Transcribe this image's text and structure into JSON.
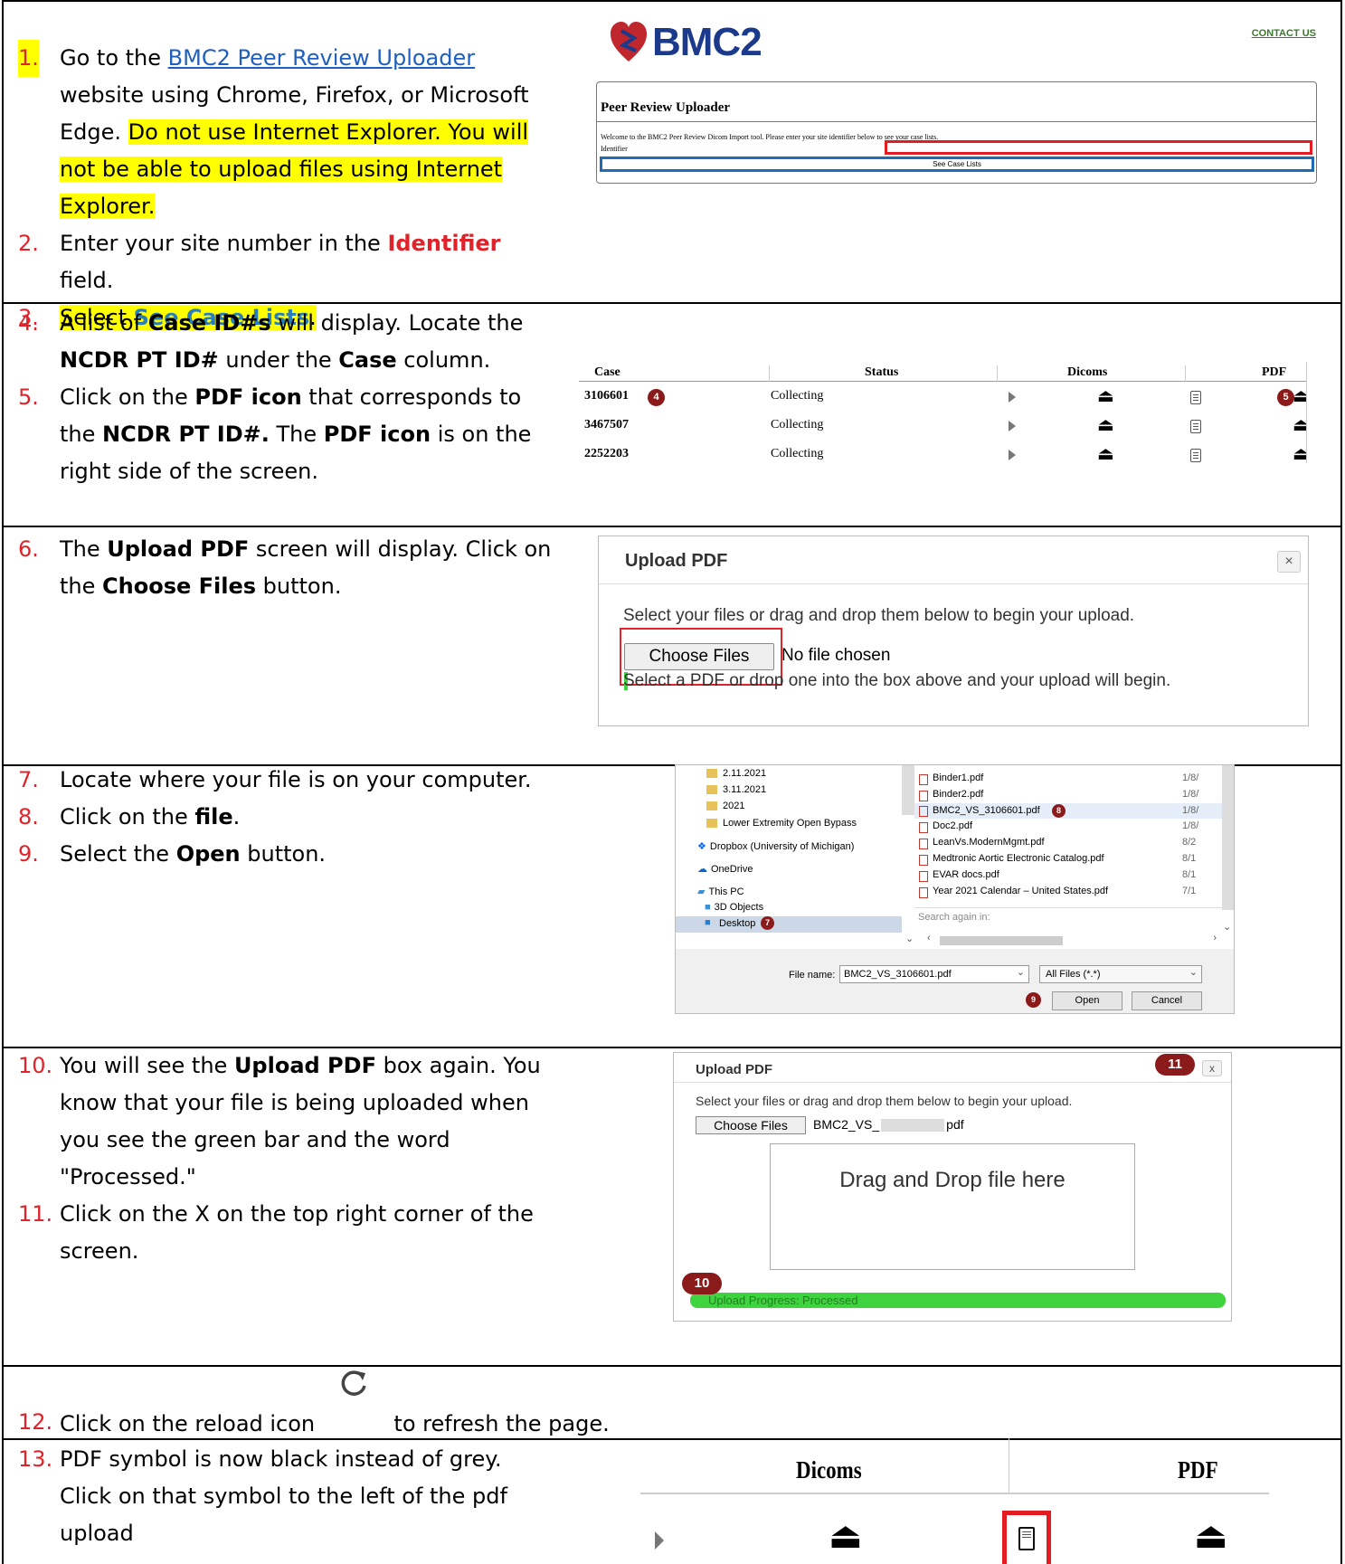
{
  "steps": {
    "s1": {
      "num": "1.",
      "pre": "Go to the ",
      "link": "BMC2 Peer Review Uploader",
      "post": " website using Chrome, Firefox, or Microsoft Edge. ",
      "warn": "Do not use Internet Explorer. You will not be able to upload files using Internet Explorer."
    },
    "s2": {
      "num": "2.",
      "pre": "Enter your site number in the ",
      "bold": "Identifier",
      "post": " field."
    },
    "s3": {
      "num": "3.",
      "pre": "Select ",
      "bold": "See Case Lists",
      "post": "."
    },
    "s4": {
      "num": "4.",
      "a": "A list of ",
      "b1": "Case ID#s",
      "c": " will display. Locate the ",
      "b2": "NCDR PT ID#",
      "d": " under the ",
      "b3": "Case",
      "e": " column."
    },
    "s5": {
      "num": "5.",
      "a": "Click on the ",
      "b1": "PDF icon",
      "c": " that corresponds to the ",
      "b2": "NCDR PT ID#.",
      "d": " The ",
      "b3": "PDF icon",
      "e": " is on the right side of the screen."
    },
    "s6": {
      "num": "6.",
      "a": "The ",
      "b1": "Upload PDF",
      "c": " screen will display. Click on the ",
      "b2": "Choose Files",
      "d": " button."
    },
    "s7": {
      "num": "7.",
      "text": "Locate where your file is on your computer."
    },
    "s8": {
      "num": "8.",
      "a": "Click on the ",
      "b1": "file",
      "c": "."
    },
    "s9": {
      "num": "9.",
      "a": "Select the ",
      "b1": "Open",
      "c": " button."
    },
    "s10": {
      "num": "10.",
      "a": "You will see the ",
      "b1": "Upload PDF",
      "c": " box again. You know that your file is being uploaded when you see the green bar and the word \"Processed.\""
    },
    "s11": {
      "num": "11.",
      "text": "Click on the X on the top right corner of the screen."
    },
    "s12": {
      "num": "12.",
      "a": "Click on the reload icon",
      "c": "to refresh the page."
    },
    "s13": {
      "num": "13.",
      "text": "PDF symbol is now black instead of grey. Click on that symbol to the left of the pdf upload"
    }
  },
  "uploader": {
    "logo": "BMC2",
    "contact": "CONTACT US",
    "title": "Peer Review Uploader",
    "welcome": "Welcome to the BMC2 Peer Review Dicom Import tool. Please enter your site identifier below to see your case lists.",
    "identifier_label": "Identifier",
    "button": "See Case Lists"
  },
  "case_table": {
    "headers": [
      "Case",
      "Status",
      "Dicoms",
      "PDF"
    ],
    "rows": [
      {
        "case": "3106601",
        "status": "Collecting"
      },
      {
        "case": "3467507",
        "status": "Collecting"
      },
      {
        "case": "2252203",
        "status": "Collecting"
      }
    ],
    "badge_case": "4",
    "badge_pdf": "5"
  },
  "upload_dialog": {
    "title": "Upload PDF",
    "close": "×",
    "instruction": "Select your files or drag and drop them below to begin your upload.",
    "choose": "Choose Files",
    "no_file": "No file chosen",
    "hint": "Select a PDF or drop one into the box above and your upload will begin."
  },
  "file_dialog": {
    "left_items": [
      "2.11.2021",
      "3.11.2021",
      "2021",
      "Lower Extremity Open Bypass",
      "Dropbox (University of Michigan)",
      "OneDrive",
      "This PC",
      "3D Objects",
      "Desktop"
    ],
    "files": [
      {
        "name": "Binder1.pdf",
        "date": "1/8/"
      },
      {
        "name": "Binder2.pdf",
        "date": "1/8/"
      },
      {
        "name": "BMC2_VS_3106601.pdf",
        "date": "1/8/"
      },
      {
        "name": "Doc2.pdf",
        "date": "1/8/"
      },
      {
        "name": "LeanVs.ModernMgmt.pdf",
        "date": "8/2"
      },
      {
        "name": "Medtronic Aortic Electronic Catalog.pdf",
        "date": "8/1"
      },
      {
        "name": "EVAR docs.pdf",
        "date": "8/1"
      },
      {
        "name": "Year 2021 Calendar – United States.pdf",
        "date": "7/1"
      }
    ],
    "search_again": "Search again in:",
    "filename_label": "File name:",
    "filename_value": "BMC2_VS_3106601.pdf",
    "filter": "All Files (*.*)",
    "open": "Open",
    "cancel": "Cancel",
    "badge7": "7",
    "badge8": "8",
    "badge9": "9"
  },
  "upload_dialog2": {
    "title": "Upload PDF",
    "close": "x",
    "instruction": "Select your files or drag and drop them below to begin your upload.",
    "choose": "Choose Files",
    "file_prefix": "BMC2_VS_",
    "file_suffix": "pdf",
    "drop": "Drag and Drop file here",
    "progress": "Upload Progress: Processed",
    "badge10": "10",
    "badge11": "11"
  },
  "pdf_table": {
    "dicoms": "Dicoms",
    "pdf": "PDF"
  },
  "colors": {
    "step_number": "#e0232a",
    "highlight": "#ffff00",
    "badge": "#8b1a1a",
    "progress": "#3fd43f",
    "link": "#1f5fbf"
  }
}
